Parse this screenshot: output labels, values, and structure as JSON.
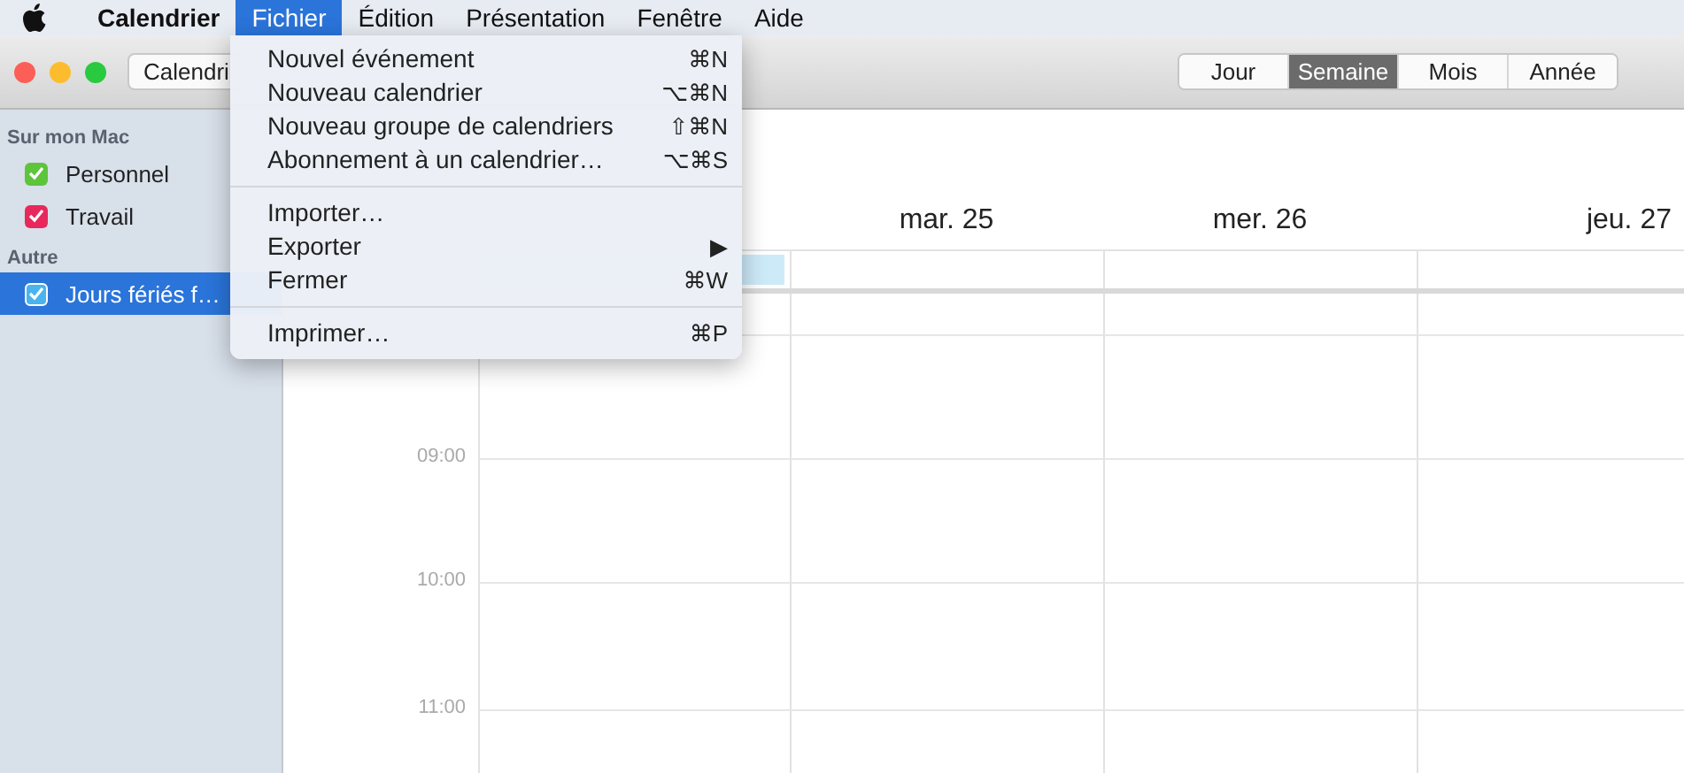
{
  "menu_bar": {
    "items": [
      {
        "label": "Calendrier",
        "kind": "app",
        "selected": false
      },
      {
        "label": "Fichier",
        "kind": "menu",
        "selected": true
      },
      {
        "label": "Édition",
        "kind": "menu",
        "selected": false
      },
      {
        "label": "Présentation",
        "kind": "menu",
        "selected": false
      },
      {
        "label": "Fenêtre",
        "kind": "menu",
        "selected": false
      },
      {
        "label": "Aide",
        "kind": "menu",
        "selected": false
      }
    ]
  },
  "open_menu": {
    "items": [
      {
        "kind": "item",
        "label": "Nouvel événement",
        "shortcut": "⌘N"
      },
      {
        "kind": "item",
        "label": "Nouveau calendrier",
        "shortcut": "⌥⌘N"
      },
      {
        "kind": "item",
        "label": "Nouveau groupe de calendriers",
        "shortcut": "⇧⌘N"
      },
      {
        "kind": "item",
        "label": "Abonnement à un calendrier…",
        "shortcut": "⌥⌘S"
      },
      {
        "kind": "separator"
      },
      {
        "kind": "item",
        "label": "Importer…"
      },
      {
        "kind": "item",
        "label": "Exporter",
        "shortcut": "▶"
      },
      {
        "kind": "item",
        "label": "Fermer",
        "shortcut": "⌘W"
      },
      {
        "kind": "separator"
      },
      {
        "kind": "item",
        "label": "Imprimer…",
        "shortcut": "⌘P"
      }
    ]
  },
  "toolbar": {
    "calendars_button": "Calendri",
    "view_tabs": [
      {
        "label": "Jour",
        "selected": false
      },
      {
        "label": "Semaine",
        "selected": true
      },
      {
        "label": "Mois",
        "selected": false
      },
      {
        "label": "Année",
        "selected": false
      }
    ]
  },
  "sidebar": {
    "groups": [
      {
        "title": "Sur mon Mac",
        "items": [
          {
            "label": "Personnel",
            "checked": true,
            "selected": false,
            "color": "#5ec43c"
          },
          {
            "label": "Travail",
            "checked": true,
            "selected": false,
            "color": "#e8285c"
          }
        ]
      },
      {
        "title": "Autre",
        "items": [
          {
            "label": "Jours fériés f…",
            "checked": true,
            "selected": true,
            "color": "#4ab4ee"
          }
        ]
      }
    ]
  },
  "week": {
    "days": [
      {
        "all_day_event": true
      },
      {
        "label": "mar. 25",
        "all_day_event": false
      },
      {
        "label": "mer. 26",
        "all_day_event": false
      },
      {
        "label": "jeu. 27",
        "all_day_event": false
      }
    ],
    "hours": [
      "09:00",
      "10:00",
      "11:00"
    ]
  }
}
